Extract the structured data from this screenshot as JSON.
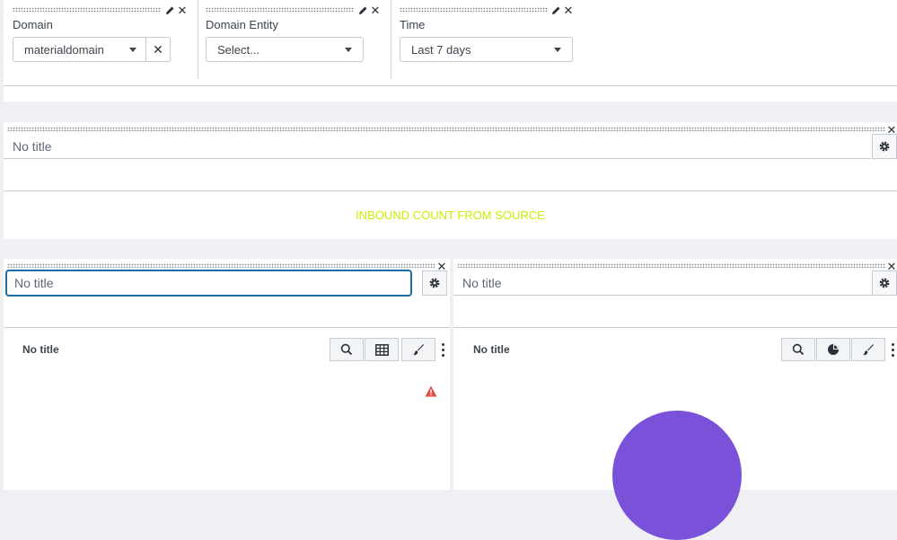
{
  "inputs": [
    {
      "label": "Domain",
      "value": "materialdomain"
    },
    {
      "label": "Domain Entity",
      "placeholder": "Select..."
    },
    {
      "label": "Time",
      "value": "Last 7 days"
    }
  ],
  "row1": {
    "title_placeholder": "No title",
    "content_text": "INBOUND COUNT FROM SOURCE"
  },
  "row2": {
    "left": {
      "title_placeholder": "No title",
      "panel_title": "No title"
    },
    "right": {
      "title_placeholder": "No title",
      "panel_title": "No title"
    }
  },
  "colors": {
    "accent_text": "#c6f000",
    "pie": "#7a52d9",
    "warning": "#dc4e41",
    "focus": "#1a6ca3"
  }
}
